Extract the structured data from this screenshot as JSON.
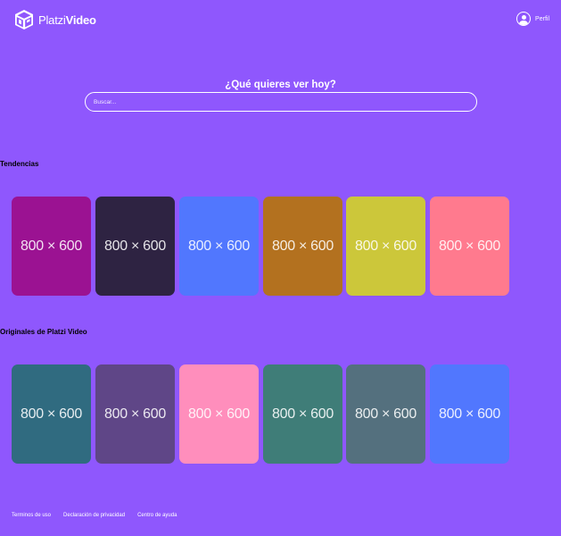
{
  "header": {
    "logo_light": "Platzi",
    "logo_bold": "Video",
    "profile_label": "Perfil"
  },
  "hero": {
    "title": "¿Qué quieres ver hoy?",
    "search_placeholder": "Buscar..."
  },
  "sections": {
    "trends": {
      "title": "Tendencias",
      "items": [
        {
          "label": "800 × 600",
          "color": "#9b1292"
        },
        {
          "label": "800 × 600",
          "color": "#2e2342"
        },
        {
          "label": "800 × 600",
          "color": "#5177fe"
        },
        {
          "label": "800 × 600",
          "color": "#b3711f"
        },
        {
          "label": "800 × 600",
          "color": "#ccc73a"
        },
        {
          "label": "800 × 600",
          "color": "#ff7a8e"
        }
      ]
    },
    "originals": {
      "title": "Originales de Platzi Video",
      "items": [
        {
          "label": "800 × 600",
          "color": "#306b80"
        },
        {
          "label": "800 × 600",
          "color": "#5f4687"
        },
        {
          "label": "800 × 600",
          "color": "#ff8ebc"
        },
        {
          "label": "800 × 600",
          "color": "#3f7d78"
        },
        {
          "label": "800 × 600",
          "color": "#54707e"
        },
        {
          "label": "800 × 600",
          "color": "#5177fe"
        }
      ]
    }
  },
  "footer": {
    "links": [
      "Terminos de uso",
      "Declaración de privacidad",
      "Centro de ayuda"
    ]
  },
  "colors": {
    "background": "#8f57fd",
    "section_title": "#000000"
  }
}
